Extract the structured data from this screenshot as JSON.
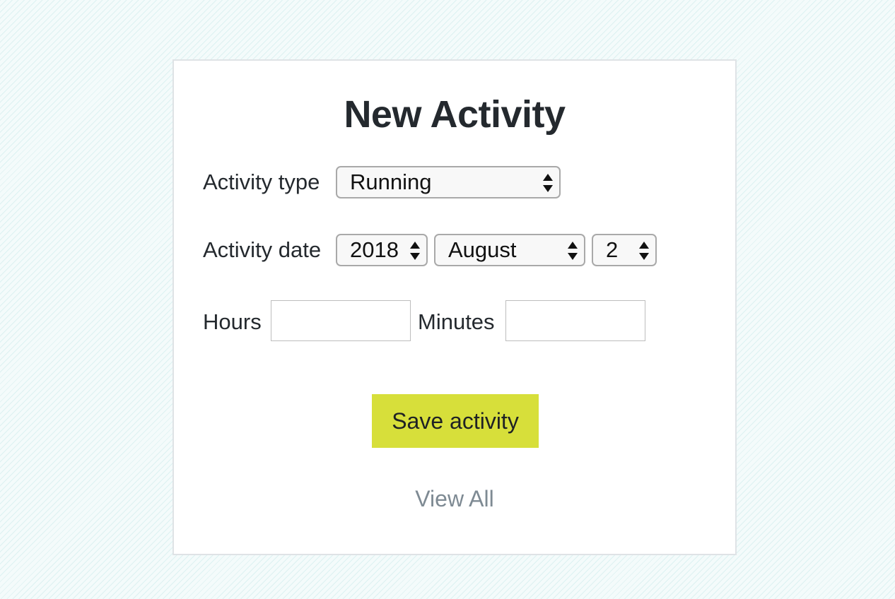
{
  "form": {
    "title": "New Activity",
    "activity_type": {
      "label": "Activity type",
      "selected": "Running"
    },
    "activity_date": {
      "label": "Activity date",
      "year": "2018",
      "month": "August",
      "day": "2"
    },
    "hours": {
      "label": "Hours",
      "value": ""
    },
    "minutes": {
      "label": "Minutes",
      "value": ""
    },
    "save_label": "Save activity",
    "view_all_label": "View All"
  },
  "colors": {
    "accent": "#d7df3a",
    "link": "#7e8a93",
    "text": "#24292e",
    "card_border": "#dfe3e6"
  },
  "icons": {
    "select_arrows": "up-down-triangle-icon"
  }
}
